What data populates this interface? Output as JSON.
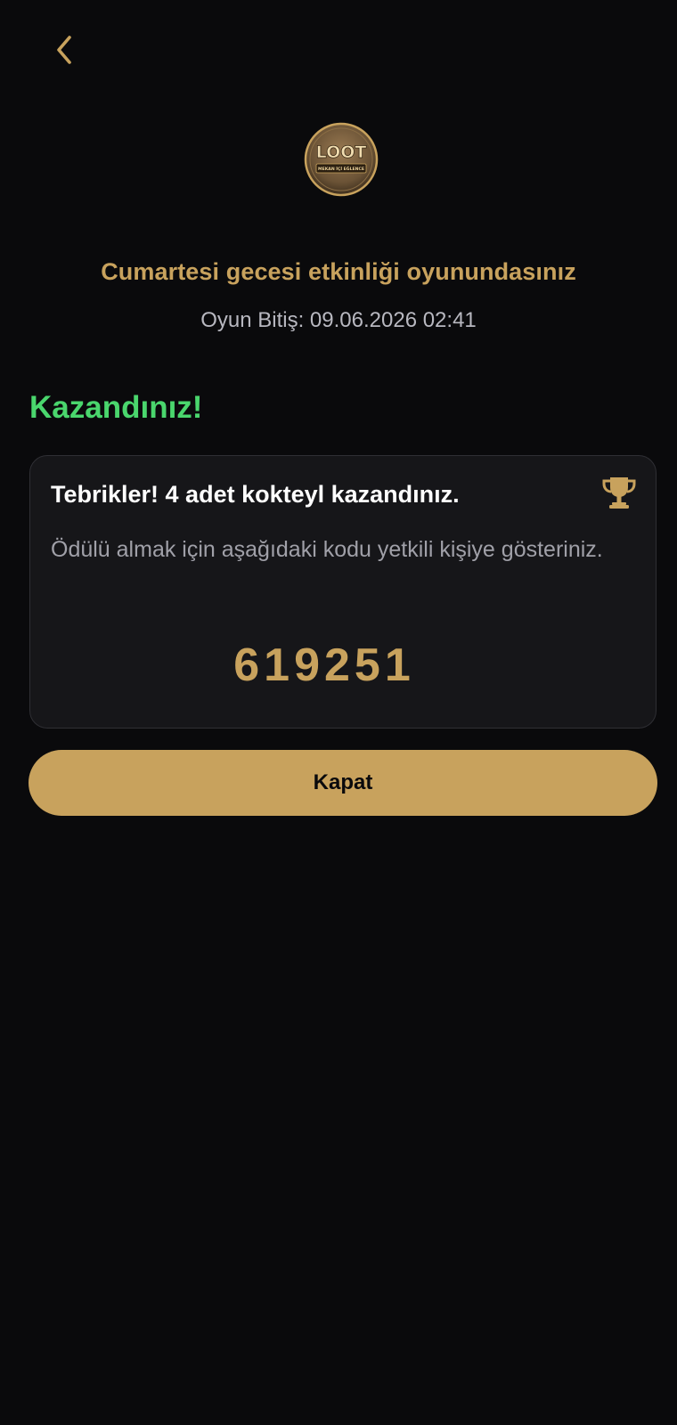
{
  "header": {
    "back_icon": "chevron-left-icon",
    "logo": {
      "text": "LOOT",
      "tagline": "MEKAN İÇİ EĞLENCE"
    }
  },
  "event": {
    "title": "Cumartesi gecesi etkinliği oyunundasınız",
    "end_time": "Oyun Bitiş: 09.06.2026 02:41"
  },
  "result": {
    "heading": "Kazandınız!"
  },
  "reward_card": {
    "title": "Tebrikler! 4 adet kokteyl kazandınız.",
    "description": "Ödülü almak için aşağıdaki kodu yetkili kişiye gösteriniz.",
    "code": "619251",
    "icon": "trophy-icon"
  },
  "actions": {
    "close_label": "Kapat"
  },
  "colors": {
    "background": "#0a0a0c",
    "accent_gold": "#c8a25d",
    "success_green": "#4ad66d",
    "card_background": "#161619",
    "muted_text": "#a0a0a8"
  }
}
